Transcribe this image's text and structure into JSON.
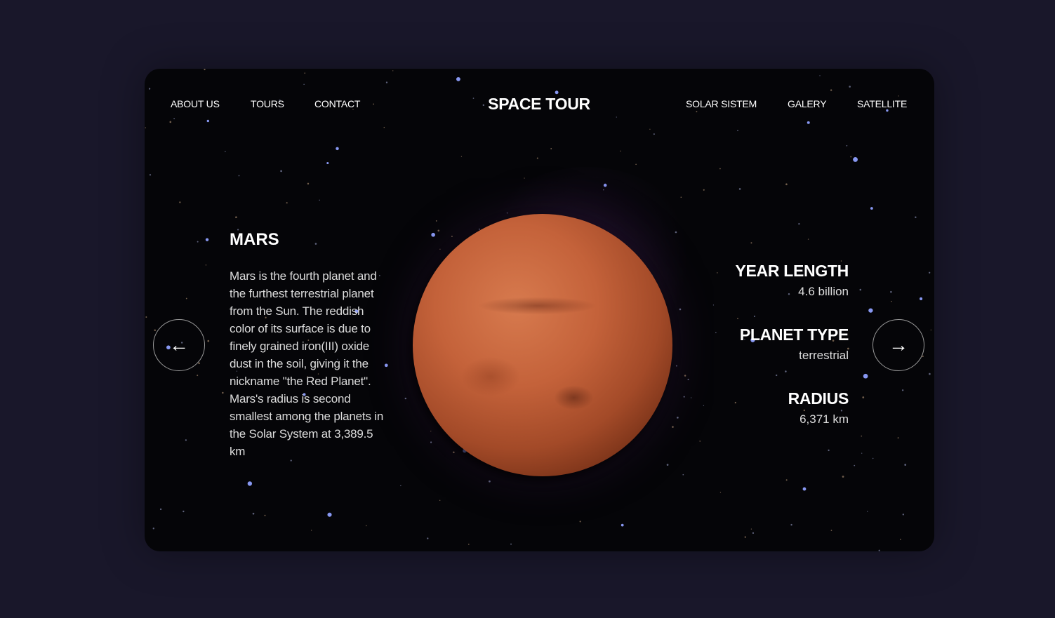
{
  "nav": {
    "left": [
      "ABOUT US",
      "TOURS",
      "CONTACT"
    ],
    "brand": "SPACE TOUR",
    "right": [
      "SOLAR SISTEM",
      "GALERY",
      "SATELLITE"
    ]
  },
  "planet": {
    "name": "MARS",
    "description": "Mars is the fourth planet and the furthest terrestrial planet from the Sun. The reddish color of its surface is due to finely grained iron(III) oxide dust in the soil, giving it the nickname \"the Red Planet\". Mars's radius is second smallest among the planets in the Solar System at 3,389.5 km",
    "stats": [
      {
        "label": "YEAR LENGTH",
        "value": "4.6 billion"
      },
      {
        "label": "PLANET TYPE",
        "value": "terrestrial"
      },
      {
        "label": "RADIUS",
        "value": "6,371 km"
      }
    ]
  },
  "controls": {
    "prev_icon": "←",
    "next_icon": "→"
  },
  "colors": {
    "page_bg": "#19172a",
    "card_bg": "#050508",
    "planet": "#c4623a"
  }
}
